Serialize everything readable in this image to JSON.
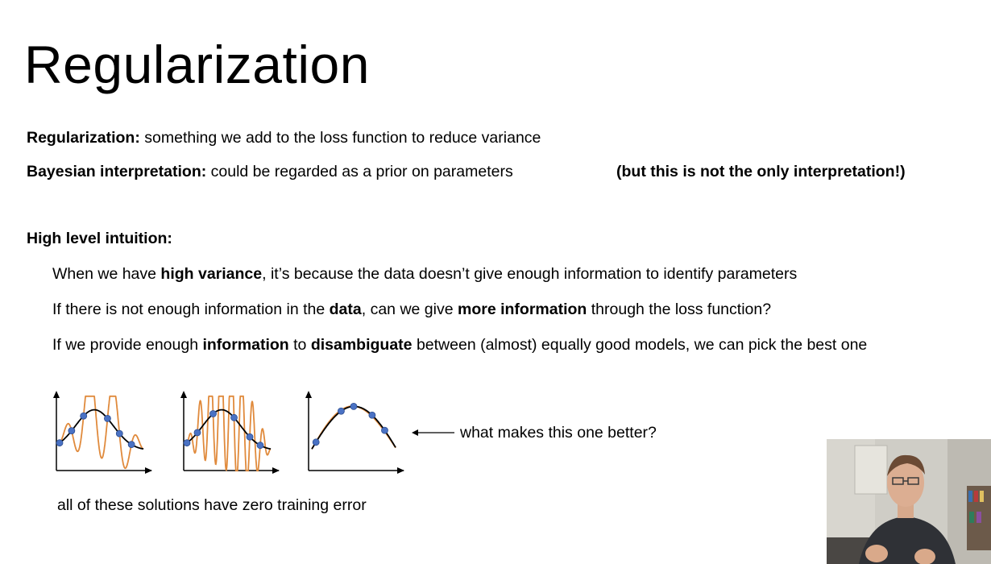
{
  "slide": {
    "title": "Regularization",
    "line1": {
      "bold": "Regularization:",
      "text": " something we add to the loss function to reduce variance"
    },
    "line2": {
      "bold": "Bayesian interpretation:",
      "text": " could be regarded as a prior on parameters",
      "aside": "(but this is not the only interpretation!)"
    },
    "intuition_heading": "High level intuition:",
    "intuition": [
      [
        {
          "t": "When we have ",
          "b": false
        },
        {
          "t": "high variance",
          "b": true
        },
        {
          "t": ", it’s because the data doesn’t give enough information to identify parameters",
          "b": false
        }
      ],
      [
        {
          "t": "If there is not enough information in the ",
          "b": false
        },
        {
          "t": "data",
          "b": true
        },
        {
          "t": ", can we give ",
          "b": false
        },
        {
          "t": "more information",
          "b": true
        },
        {
          "t": " through the loss function?",
          "b": false
        }
      ],
      [
        {
          "t": "If we provide enough ",
          "b": false
        },
        {
          "t": "information",
          "b": true
        },
        {
          "t": " to ",
          "b": false
        },
        {
          "t": "disambiguate",
          "b": true
        },
        {
          "t": " between (almost) equally good models, we can pick the best one",
          "b": false
        }
      ]
    ],
    "arrow_label": "what makes this one better?",
    "caption": "all of these solutions have zero training error"
  },
  "colors": {
    "true_curve": "#000000",
    "fit_curve": "#e08a3c",
    "data_point": "#4a72c4",
    "data_point_edge": "#2d4d8f"
  },
  "plots": [
    {
      "name": "moderate-overfit",
      "fit_cycles": 3.5,
      "fit_amplitude": 0.42
    },
    {
      "name": "severe-overfit",
      "fit_cycles": 8,
      "fit_amplitude": 0.55
    },
    {
      "name": "good-fit",
      "fit_cycles": 0,
      "fit_amplitude": 0.02
    }
  ]
}
